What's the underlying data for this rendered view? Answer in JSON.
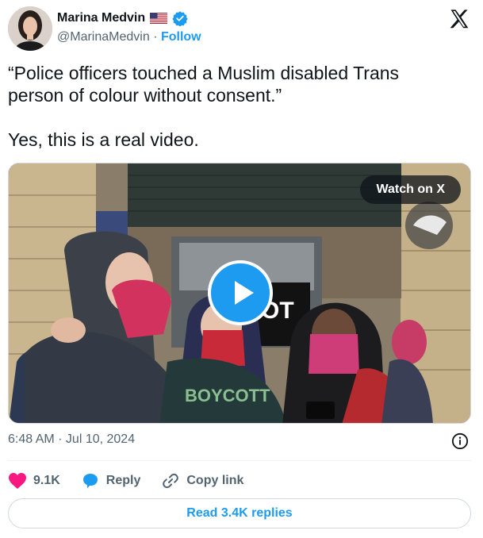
{
  "author": {
    "name": "Marina Medvin",
    "handle": "@MarinaMedvin",
    "separator": "·",
    "follow_label": "Follow",
    "flag_icon": "us-flag-icon",
    "verified_icon": "verified-badge-icon"
  },
  "tweet": {
    "line1": "“Police officers touched a Muslim disabled Trans person of colour without consent.”",
    "line2": "Yes, this is a real video."
  },
  "media": {
    "watch_label": "Watch on X",
    "sign_text": "OT",
    "shirt_text": "BOYCOTT"
  },
  "meta": {
    "time": "6:48 AM · Jul 10, 2024"
  },
  "actions": {
    "like_count": "9.1K",
    "reply_label": "Reply",
    "copy_label": "Copy link"
  },
  "read_replies_label": "Read 3.4K replies",
  "colors": {
    "accent": "#1d9bf0",
    "like": "#f91880",
    "text": "#0f1419",
    "muted": "#536471"
  }
}
